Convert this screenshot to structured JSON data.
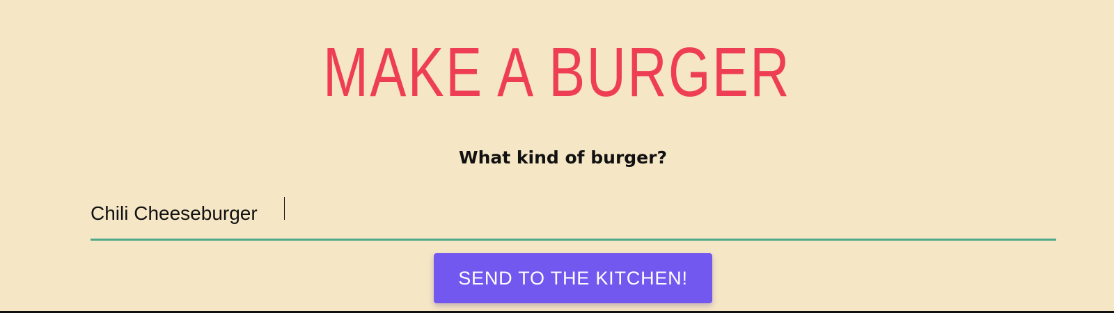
{
  "theme": {
    "background": "#f5e6c5",
    "title_color": "#ee3e55",
    "text_color": "#111111",
    "field_underline": "#4ea98c",
    "button_bg": "#7258ee",
    "button_text": "#ffffff"
  },
  "heading": {
    "title": "MAKE A BURGER"
  },
  "form": {
    "question": "What kind of burger?",
    "input_value": "Chili Cheeseburger",
    "submit_label": "SEND TO THE KITCHEN!"
  }
}
